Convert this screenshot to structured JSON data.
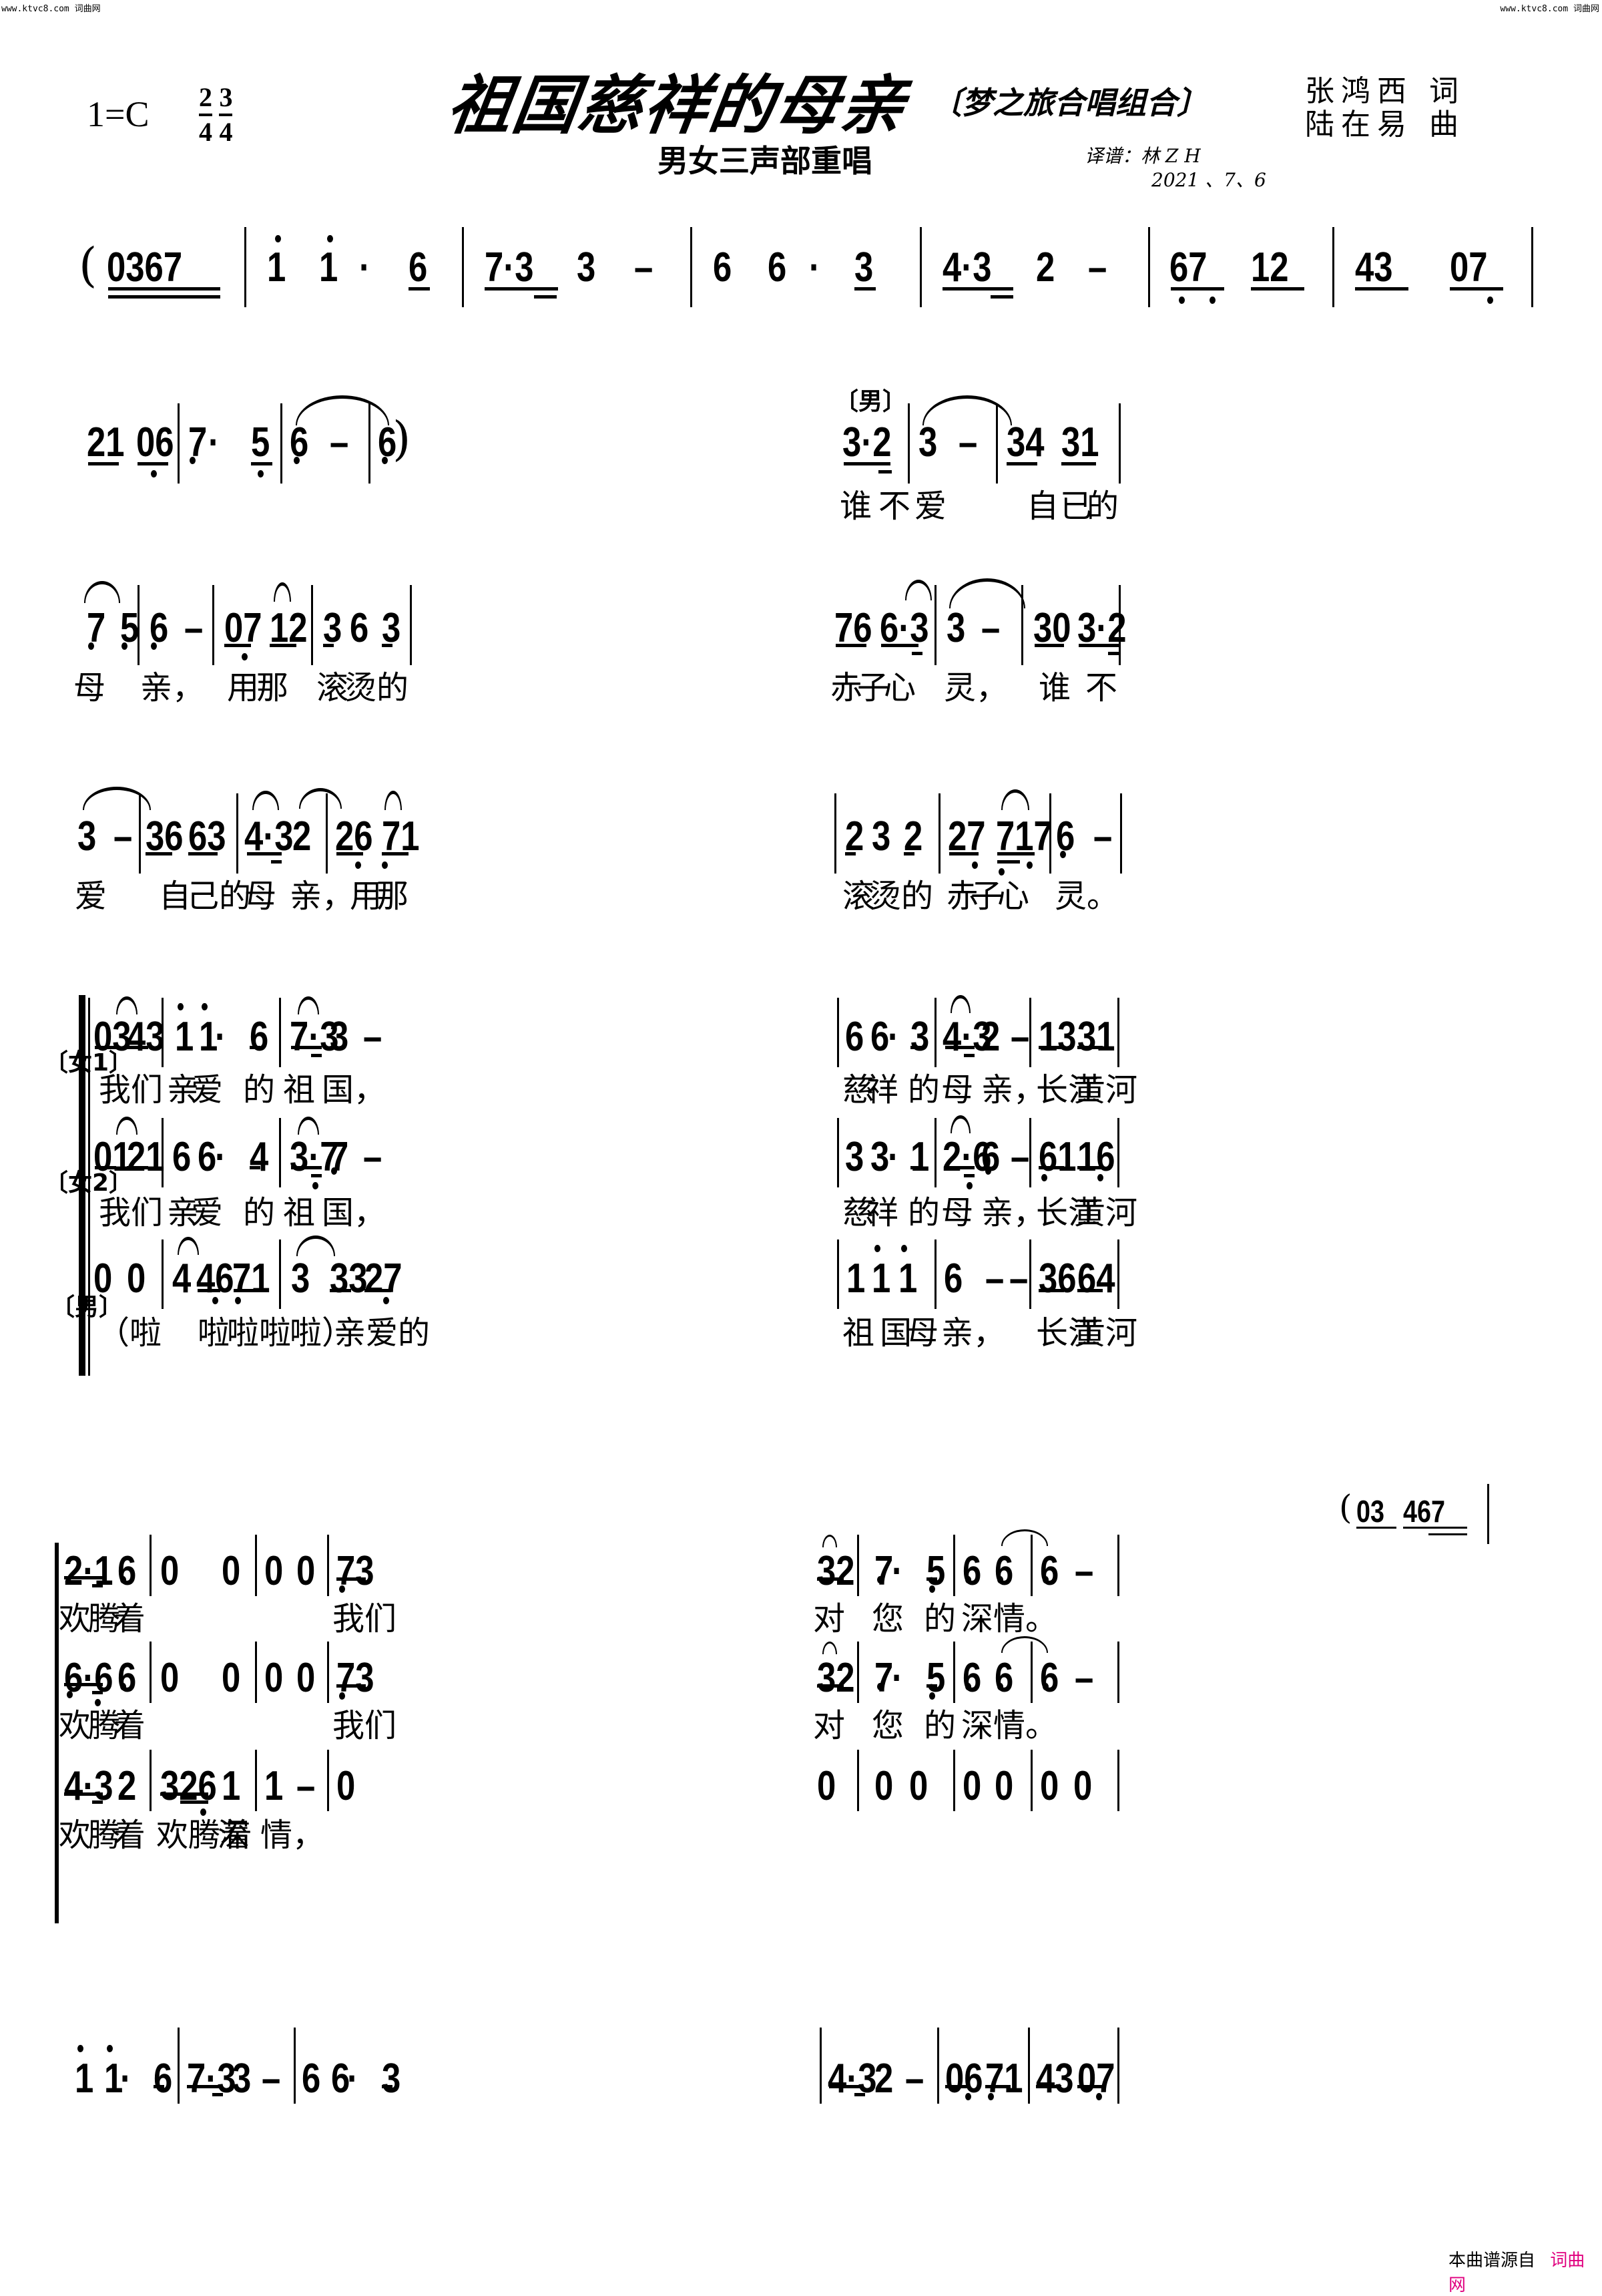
{
  "watermark": {
    "left": "www.ktvc8.com 词曲网",
    "right": "www.ktvc8.com 词曲网"
  },
  "header": {
    "key": "1=C",
    "time_signatures": [
      {
        "num": "2",
        "den": "4"
      },
      {
        "num": "3",
        "den": "4"
      }
    ],
    "title": "祖国慈祥的母亲",
    "title_note": "〔梦之旅合唱组合〕",
    "subtitle": "男女三声部重唱",
    "lyricist": "张鸿西 词",
    "composer": "陆在易 曲",
    "arranger": "译谱：林 Z H",
    "date": "2021 、7、6"
  },
  "systems": [
    {
      "id": "s1",
      "notes": [
        "(",
        "0367",
        "i",
        "i",
        "·",
        "6",
        "7·3",
        "3",
        "–",
        "6",
        "6",
        "·",
        "3",
        "4·3",
        "2",
        "–",
        "67",
        "12",
        "43",
        "07"
      ],
      "lyrics": []
    },
    {
      "id": "s2",
      "part_label": "〔男〕",
      "notes": [
        "21",
        "06",
        "7",
        "·",
        "5",
        "6",
        "–",
        "6",
        ")",
        "3·2",
        "3",
        "–",
        "34",
        "31"
      ],
      "lyrics": [
        "谁",
        "不",
        "爱",
        "自",
        "已",
        "的"
      ]
    },
    {
      "id": "s3",
      "notes": [
        "7",
        "5",
        "6",
        "–",
        "07",
        "12",
        "3",
        "6",
        "3",
        "76",
        "6·3",
        "3",
        "–",
        "30",
        "3·2"
      ],
      "lyrics": [
        "母",
        "亲，",
        "用",
        "那",
        "滚",
        "烫",
        "的",
        "赤",
        "子",
        "心",
        "灵，",
        "谁",
        "不"
      ]
    },
    {
      "id": "s4",
      "notes": [
        "3",
        "–",
        "36",
        "63",
        "4·3",
        "2",
        "26",
        "71",
        "2",
        "3",
        "2",
        "27",
        "717",
        "6",
        "–"
      ],
      "lyrics": [
        "爱",
        "自",
        "己的",
        "母",
        "亲，",
        "用",
        "那",
        "滚",
        "烫",
        "的",
        "赤",
        "子",
        "心",
        "灵。"
      ]
    },
    {
      "id": "s5",
      "parts": [
        {
          "label": "〔女1〕",
          "notes": [
            "03",
            "43",
            "i",
            "i",
            "·",
            "6",
            "7·3",
            "3",
            "–",
            "6",
            "6",
            "·",
            "3",
            "4·3",
            "2",
            "–",
            "13",
            "31"
          ],
          "lyrics": [
            "我",
            "们",
            "亲",
            "爱",
            "的",
            "祖",
            "国，",
            "慈",
            "祥",
            "的",
            "母",
            "亲，",
            "长江",
            "黄河"
          ]
        },
        {
          "label": "〔女2〕",
          "notes": [
            "01",
            "21",
            "6",
            "6",
            "·",
            "4",
            "3·7",
            "7",
            "–",
            "3",
            "3",
            "·",
            "1",
            "2·6",
            "6",
            "–",
            "61",
            "16"
          ],
          "lyrics": [
            "我",
            "们",
            "亲",
            "爱",
            "的",
            "祖",
            "国，",
            "慈",
            "祥",
            "的",
            "母",
            "亲，",
            "长江",
            "黄河"
          ]
        },
        {
          "label": "〔男〕",
          "notes": [
            "0",
            "0",
            "4",
            "46",
            "71",
            "3",
            "33",
            "27",
            "1",
            "i",
            "i",
            "6",
            "–",
            "–",
            "36",
            "64"
          ],
          "lyrics": [
            "（啦",
            "啦",
            "啦啦",
            "啦）",
            "亲爱的",
            "祖",
            "国",
            "母",
            "亲，",
            "长江",
            "黄河"
          ]
        }
      ]
    },
    {
      "id": "s6",
      "intro": {
        "paren": "(",
        "notes": [
          "03",
          "467"
        ]
      },
      "parts": [
        {
          "notes": [
            "2·1",
            "6",
            "0",
            "0",
            "0",
            "0",
            "73",
            "32",
            "7",
            "·",
            "5",
            "6",
            "6",
            "6",
            "–"
          ],
          "lyrics": [
            "欢",
            "腾",
            "着",
            "我们",
            "对",
            "您",
            "的",
            "深",
            "情。"
          ]
        },
        {
          "notes": [
            "6·6",
            "6",
            "0",
            "0",
            "0",
            "0",
            "73",
            "32",
            "7",
            "·",
            "5",
            "6",
            "6",
            "6",
            "–"
          ],
          "lyrics": [
            "欢",
            "腾",
            "着",
            "我们",
            "对",
            "您",
            "的",
            "深",
            "情。"
          ]
        },
        {
          "notes": [
            "4·3",
            "2",
            "326",
            "1",
            "1",
            "–",
            "0",
            "0",
            "0",
            "0",
            "0",
            "0",
            "0",
            "0"
          ],
          "lyrics": [
            "欢",
            "腾",
            "着",
            "欢腾着",
            "深",
            "情，"
          ]
        }
      ]
    },
    {
      "id": "s7",
      "notes": [
        "i",
        "i",
        "·",
        "6",
        "7·3",
        "3",
        "–",
        "6",
        "6",
        "·",
        "3",
        "4·3",
        "2",
        "–",
        "06",
        "71",
        "43",
        "07"
      ],
      "lyrics": []
    }
  ],
  "footer": {
    "source_label": "本曲谱源自",
    "site_name": "词曲网",
    "site_color": "#e0007f"
  }
}
